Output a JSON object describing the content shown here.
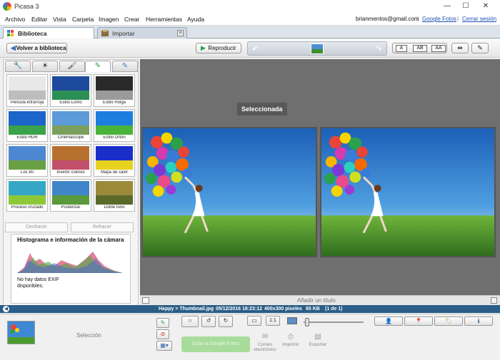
{
  "window": {
    "title": "Picasa 3",
    "minimize": "—",
    "maximize": "☐",
    "close": "✕"
  },
  "menu": {
    "items": [
      "Archivo",
      "Editar",
      "Vista",
      "Carpeta",
      "Imagen",
      "Crear",
      "Herramientas",
      "Ayuda"
    ],
    "account": "brianmentos@gmail.com",
    "sep": "|",
    "google_photos": "Google Fotos",
    "sign_out": "Cerrar sesión"
  },
  "tabs": {
    "library": "Biblioteca",
    "import": "Importar",
    "close_glyph": "✕"
  },
  "toolbar": {
    "back": "Volver a biblioteca",
    "play": "Reproducir",
    "caption_a": "A",
    "caption_ab": "AB",
    "caption_aa": "AA"
  },
  "panel_tabs": [
    "wrench-icon",
    "sun-icon",
    "brush-icon",
    "brush-active-icon",
    "brush-blue-icon"
  ],
  "effects": [
    {
      "label": "Película infrarroja",
      "colors": [
        "#e8e8e8",
        "#bdbdbd"
      ]
    },
    {
      "label": "Estilo Lomo",
      "colors": [
        "#1d4a9c",
        "#2b8f55"
      ]
    },
    {
      "label": "Estilo Holga",
      "colors": [
        "#2a2a2a",
        "#9a9a9a"
      ]
    },
    {
      "label": "Estilo HDR",
      "colors": [
        "#1b66c8",
        "#3aa24a"
      ]
    },
    {
      "label": "Cinemascope",
      "colors": [
        "#5c9ad8",
        "#7aa05c"
      ]
    },
    {
      "label": "Estilo Orton",
      "colors": [
        "#1e7ee0",
        "#48b43a"
      ]
    },
    {
      "label": "Los 80",
      "colors": [
        "#4e87d2",
        "#6aa044"
      ]
    },
    {
      "label": "Invertir colores",
      "colors": [
        "#b8702e",
        "#c2506a"
      ]
    },
    {
      "label": "Mapa de calor",
      "colors": [
        "#1a2fc9",
        "#e8d220"
      ]
    },
    {
      "label": "Proceso cruzado",
      "colors": [
        "#36a6c6",
        "#8ec838"
      ]
    },
    {
      "label": "Posterizar",
      "colors": [
        "#3f86c8",
        "#5a9a3a"
      ]
    },
    {
      "label": "Doble tono",
      "colors": [
        "#9a8a3a",
        "#5a6a2a"
      ]
    }
  ],
  "undo": "Deshacer",
  "redo": "Rehacer",
  "histogram": {
    "title": "Histograma e información de la cámara",
    "exif": "No hay datos EXIF disponibles."
  },
  "main": {
    "selected_badge": "Seleccionada",
    "caption_placeholder": "Añadir un título"
  },
  "status": {
    "path": "Happy > Thumbnail.jpg",
    "datetime": "05/12/2016 18:23:12",
    "dimensions": "400x300 píxeles",
    "size": "65 KB",
    "position": "(1 de 1)"
  },
  "tray": {
    "selection_label": "Selección",
    "share_button": "Subir a Google Fotos",
    "email": "Correo electrónico",
    "print": "Imprimir",
    "export": "Exportar",
    "ratio_label": "1:1"
  },
  "colors": {
    "status_bar": "#2a5d87",
    "main_bg": "#6f6f6f",
    "accent_green": "#a8dc9a"
  }
}
